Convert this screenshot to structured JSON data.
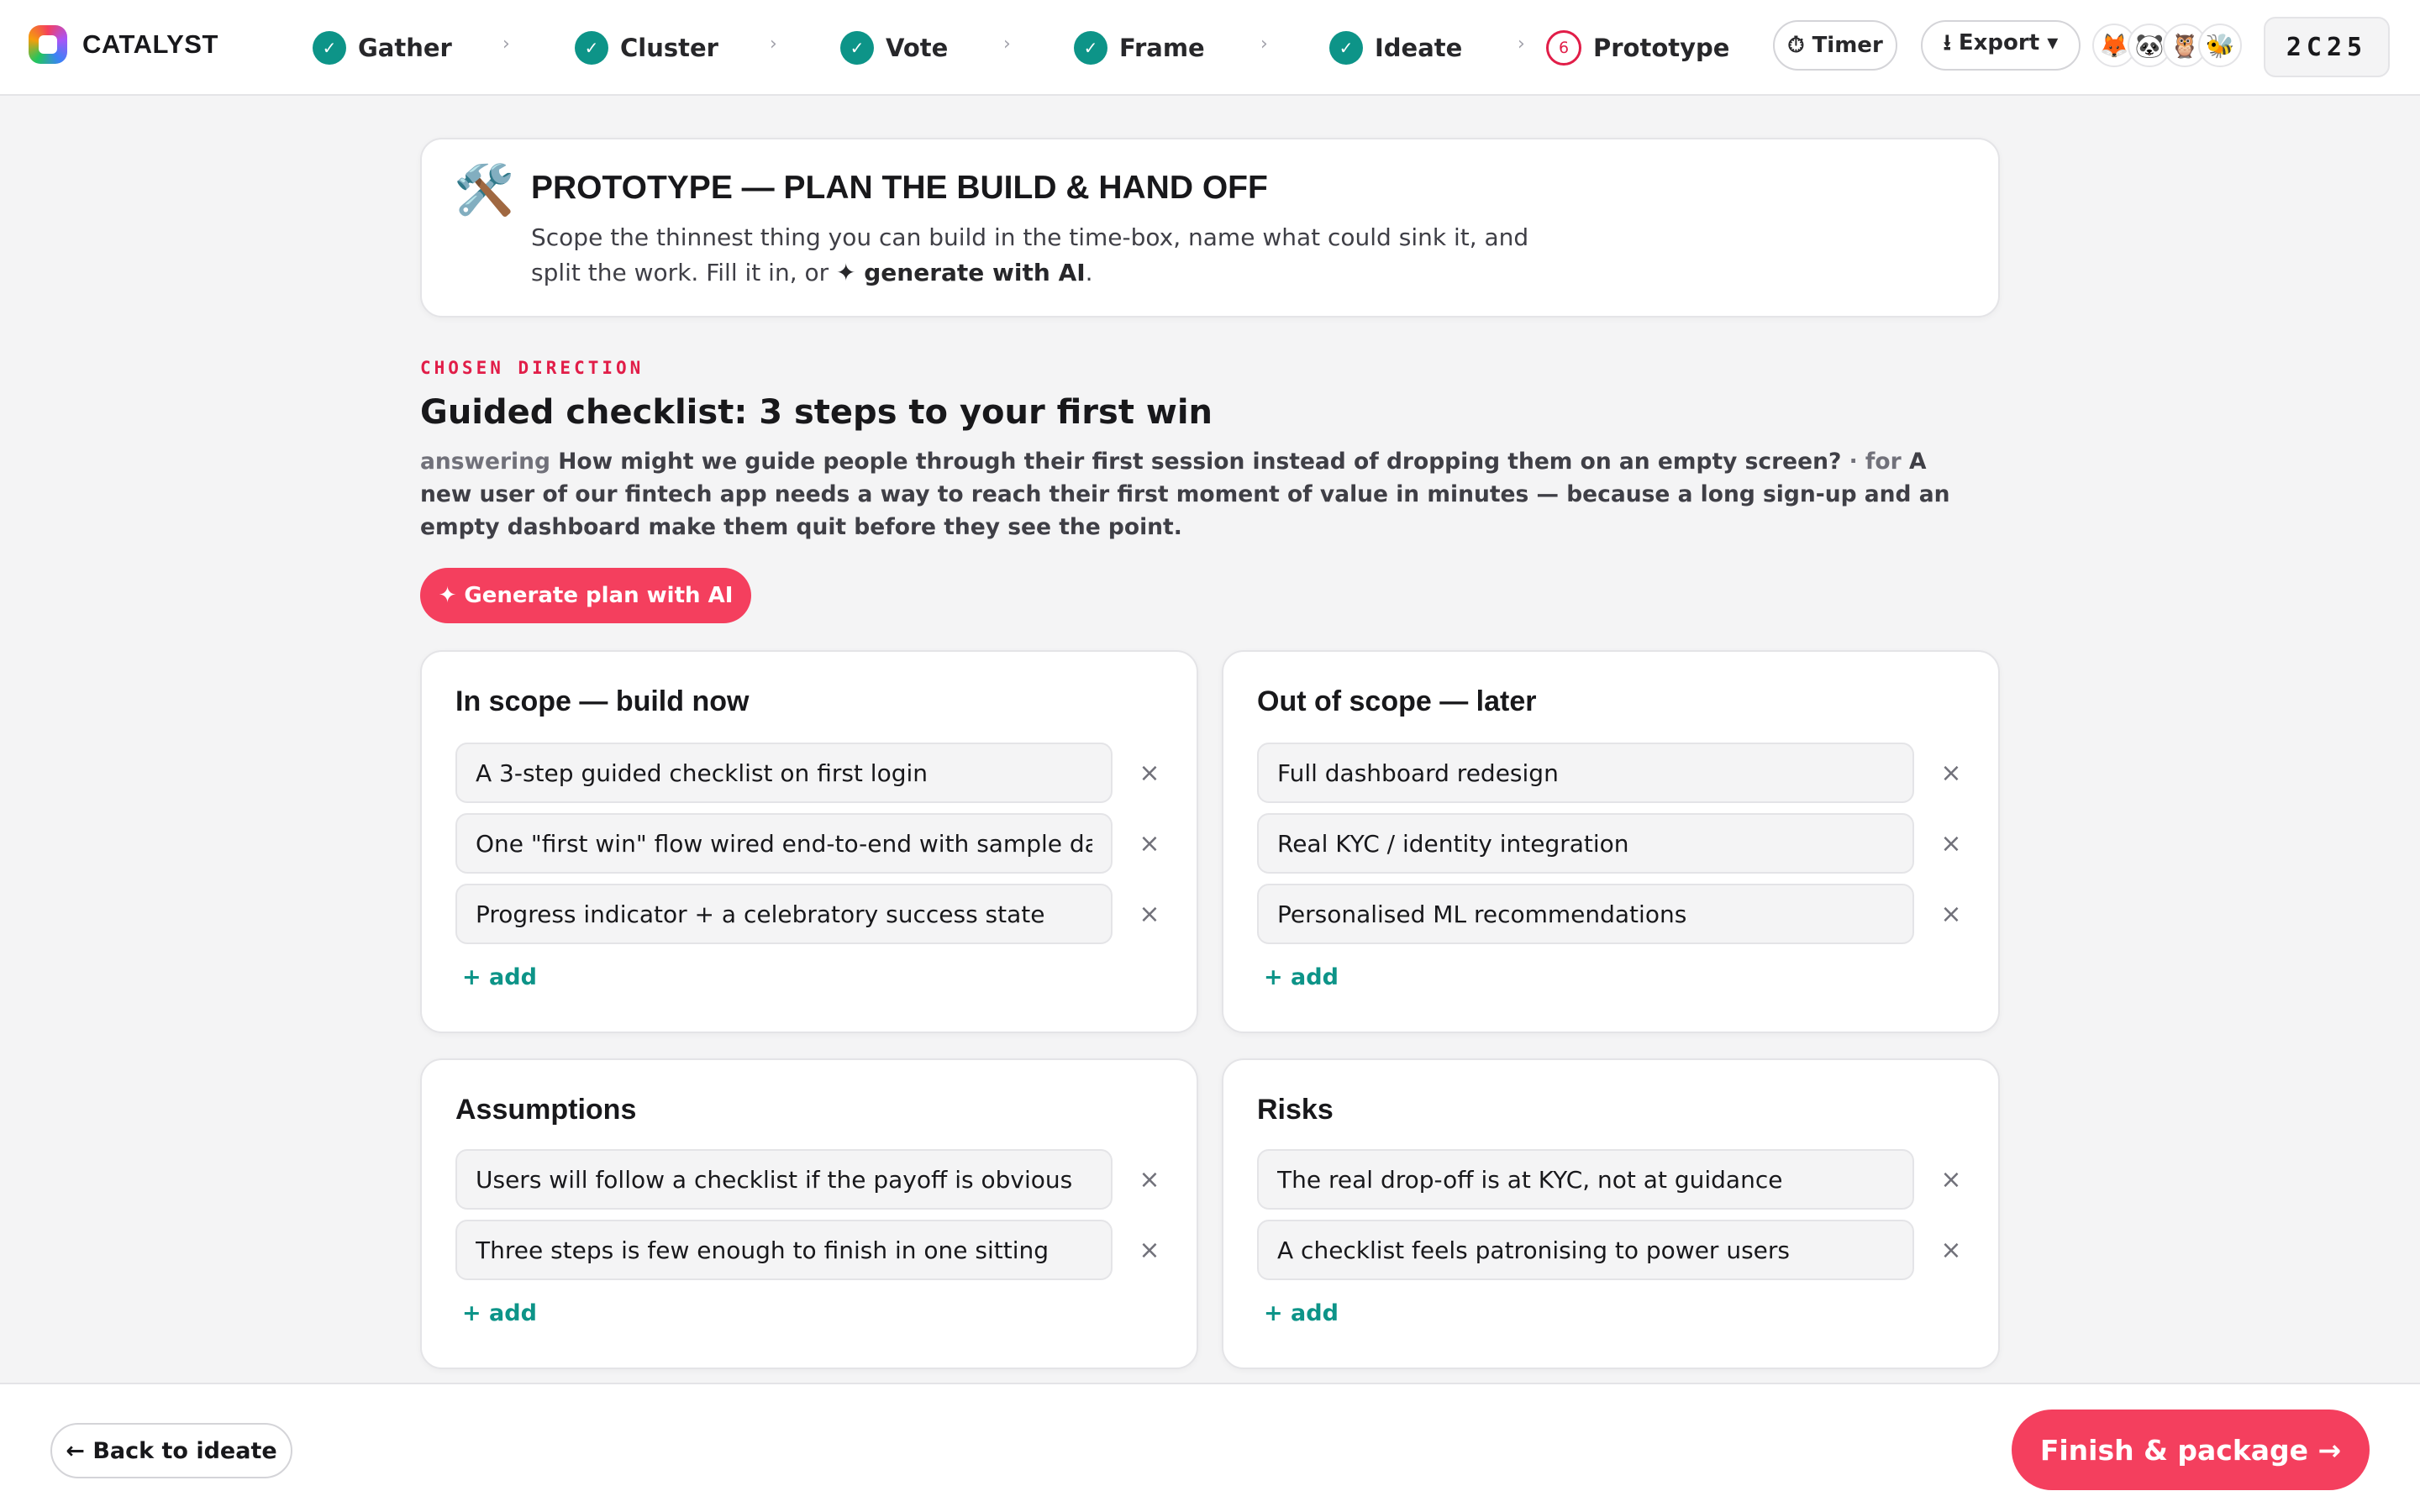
{
  "app": {
    "name": "CATALYST",
    "room_code": "2C25"
  },
  "steps": [
    {
      "label": "Gather",
      "status": "done",
      "icon": "check-icon"
    },
    {
      "label": "Cluster",
      "status": "done",
      "icon": "check-icon"
    },
    {
      "label": "Vote",
      "status": "done",
      "icon": "check-icon"
    },
    {
      "label": "Frame",
      "status": "done",
      "icon": "check-icon"
    },
    {
      "label": "Ideate",
      "status": "done",
      "icon": "check-icon"
    },
    {
      "label": "Prototype",
      "status": "current",
      "number": "6"
    }
  ],
  "toolbar": {
    "timer_label": "⏱ Timer",
    "export_label": "⭳ Export ▾"
  },
  "participants": [
    "🦊",
    "🐼",
    "🦉",
    "🐝"
  ],
  "hero": {
    "icon": "🛠️",
    "title": "PROTOTYPE — PLAN THE BUILD & HAND OFF",
    "desc_prefix": "Scope the thinnest thing you can build in the time-box, name what could sink it, and split the work. Fill it in, or ",
    "desc_action": "✦ generate with AI",
    "desc_suffix": "."
  },
  "direction": {
    "eyebrow": "CHOSEN DIRECTION",
    "title": "Guided checklist: 3 steps to your first win",
    "answering_label": "answering",
    "question": "How might we guide people through their first session instead of dropping them on an empty screen?",
    "for_label": "· for",
    "problem": "A new user of our fintech app needs a way to reach their first moment of value in minutes — because a long sign-up and an empty dashboard make them quit before they see the point."
  },
  "generate_button": "✦ Generate plan with AI",
  "cards": {
    "in_scope": {
      "title": "In scope — build now",
      "items": [
        "A 3-step guided checklist on first login",
        "One \"first win\" flow wired end-to-end with sample data",
        "Progress indicator + a celebratory success state"
      ],
      "add_label": "+ add"
    },
    "out_scope": {
      "title": "Out of scope — later",
      "items": [
        "Full dashboard redesign",
        "Real KYC / identity integration",
        "Personalised ML recommendations"
      ],
      "add_label": "+ add"
    },
    "assumptions": {
      "title": "Assumptions",
      "items": [
        "Users will follow a checklist if the payoff is obvious",
        "Three steps is few enough to finish in one sitting"
      ],
      "add_label": "+ add"
    },
    "risks": {
      "title": "Risks",
      "items": [
        "The real drop-off is at KYC, not at guidance",
        "A checklist feels patronising to power users"
      ],
      "add_label": "+ add"
    }
  },
  "remove_glyph": "×",
  "footer": {
    "back_label": "← Back to ideate",
    "finish_label": "Finish & package →"
  },
  "colors": {
    "accent": "#f43f5e",
    "done": "#0d9488",
    "current": "#e11d48",
    "background": "#f4f4f5"
  }
}
